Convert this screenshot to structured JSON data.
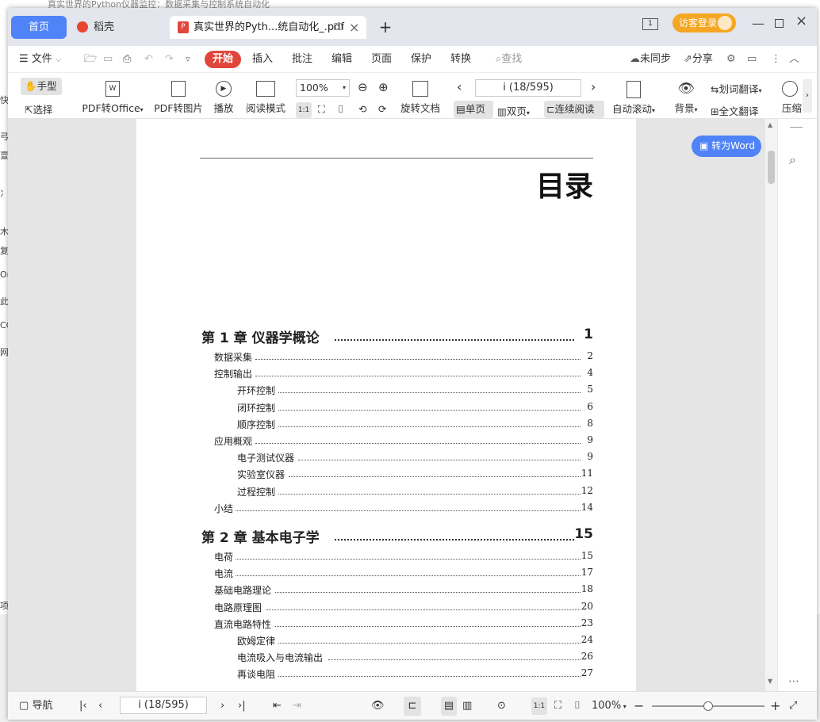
{
  "background_window": {
    "title": "真实世界的Python仪器监控：数据采集与控制系统自动化",
    "left_labels": [
      "快",
      "",
      "弓",
      "亶",
      "",
      "冫",
      "",
      "木",
      "复",
      "Or",
      "此",
      "CC",
      "网",
      "",
      "",
      "项目"
    ]
  },
  "tabs": {
    "home": "首页",
    "daoke": "稻壳",
    "doc": "真实世界的Pyth...统自动化_.pdf"
  },
  "title_controls": {
    "guest_login": "访客登录"
  },
  "menu": {
    "file": "文件",
    "start": "开始",
    "insert": "插入",
    "comment": "批注",
    "edit": "编辑",
    "page": "页面",
    "protect": "保护",
    "convert": "转换",
    "search_placeholder": "查找",
    "unsync": "未同步",
    "share": "分享"
  },
  "toolbar": {
    "hand": "手型",
    "select": "选择",
    "pdf_office": "PDF转Office",
    "pdf_image": "PDF转图片",
    "play": "播放",
    "read_mode": "阅读模式",
    "zoom": "100%",
    "page_indicator": "i (18/595)",
    "rotate": "旋转文档",
    "single": "单页",
    "double": "双页",
    "continuous": "连续阅读",
    "autoscroll": "自动滚动",
    "background": "背景",
    "word_translate": "划词翻译",
    "full_translate": "全文翻译",
    "compress": "压缩"
  },
  "convert_word": "转为Word",
  "toc": {
    "title": "目录",
    "chapters": [
      {
        "label": "第 1 章  仪器学概论",
        "page": "1",
        "entries": [
          {
            "label": "数据采集",
            "page": "2",
            "level": 1
          },
          {
            "label": "控制输出",
            "page": "4",
            "level": 1
          },
          {
            "label": "开环控制",
            "page": "5",
            "level": 2
          },
          {
            "label": "闭环控制",
            "page": "6",
            "level": 2
          },
          {
            "label": "顺序控制",
            "page": "8",
            "level": 2
          },
          {
            "label": "应用概观",
            "page": "9",
            "level": 1
          },
          {
            "label": "电子测试仪器",
            "page": "9",
            "level": 2
          },
          {
            "label": "实验室仪器",
            "page": "11",
            "level": 2
          },
          {
            "label": "过程控制",
            "page": "12",
            "level": 2
          },
          {
            "label": "小结",
            "page": "14",
            "level": 1
          }
        ]
      },
      {
        "label": "第 2 章  基本电子学",
        "page": "15",
        "entries": [
          {
            "label": "电荷",
            "page": "15",
            "level": 1
          },
          {
            "label": "电流",
            "page": "17",
            "level": 1
          },
          {
            "label": "基础电路理论",
            "page": "18",
            "level": 1
          },
          {
            "label": "电路原理图",
            "page": "20",
            "level": 1
          },
          {
            "label": "直流电路特性",
            "page": "23",
            "level": 1
          },
          {
            "label": "欧姆定律",
            "page": "24",
            "level": 2
          },
          {
            "label": "电流吸入与电流输出",
            "page": "26",
            "level": 2
          },
          {
            "label": "再谈电阻",
            "page": "27",
            "level": 2
          }
        ]
      }
    ]
  },
  "status": {
    "nav": "导航",
    "page_indicator": "i (18/595)",
    "zoom": "100%",
    "zoom_level": 0.5
  }
}
